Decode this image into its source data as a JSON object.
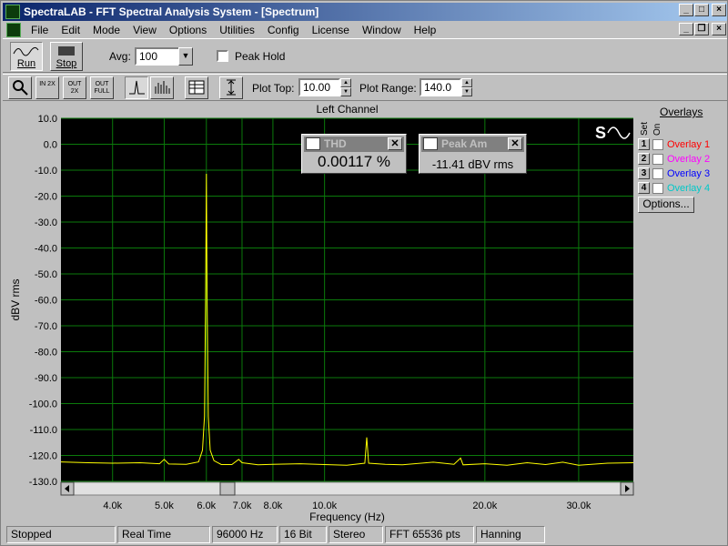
{
  "window": {
    "title": "SpectraLAB - FFT Spectral Analysis System - [Spectrum]",
    "controls": [
      "_",
      "□",
      "×"
    ],
    "doc_controls": [
      "_",
      "❐",
      "×"
    ]
  },
  "menu": [
    "File",
    "Edit",
    "Mode",
    "View",
    "Options",
    "Utilities",
    "Config",
    "License",
    "Window",
    "Help"
  ],
  "toolbar": {
    "run_label": "Run",
    "stop_label": "Stop",
    "avg_label": "Avg:",
    "avg_value": "100",
    "peak_hold_label": "Peak Hold",
    "zoom_in_label": "IN 2X",
    "zoom_out_label": "OUT 2X",
    "zoom_full_label": "OUT FULL",
    "plot_top_label": "Plot Top:",
    "plot_top_value": "10.00",
    "plot_range_label": "Plot Range:",
    "plot_range_value": "140.0"
  },
  "plot": {
    "channel_title": "Left Channel",
    "xlabel": "Frequency (Hz)",
    "ylabel": "dBV rms",
    "logo_text": "S",
    "background": "#000000",
    "grid_color": "#0b7a0b",
    "trace_color": "#ffff00"
  },
  "chart_data": {
    "type": "line",
    "title": "Left Channel",
    "xlabel": "Frequency (Hz)",
    "ylabel": "dBV rms",
    "x_scale": "log",
    "xlim": [
      3200,
      38000
    ],
    "ylim": [
      -130,
      10
    ],
    "x_ticks": [
      "4.0k",
      "5.0k",
      "6.0k",
      "7.0k",
      "8.0k",
      "10.0k",
      "20.0k",
      "30.0k"
    ],
    "x_tick_values": [
      4000,
      5000,
      6000,
      7000,
      8000,
      10000,
      20000,
      30000
    ],
    "y_ticks": [
      "10.0",
      "0.0",
      "-10.0",
      "-20.0",
      "-30.0",
      "-40.0",
      "-50.0",
      "-60.0",
      "-70.0",
      "-80.0",
      "-90.0",
      "-100.0",
      "-110.0",
      "-120.0",
      "-130.0"
    ],
    "y_tick_values": [
      10,
      0,
      -10,
      -20,
      -30,
      -40,
      -50,
      -60,
      -70,
      -80,
      -90,
      -100,
      -110,
      -120,
      -130
    ],
    "grid": true,
    "series": [
      {
        "points": [
          [
            3200,
            -122.5
          ],
          [
            3600,
            -122.8
          ],
          [
            4000,
            -123.0
          ],
          [
            4500,
            -122.8
          ],
          [
            4900,
            -123.2
          ],
          [
            5000,
            -121.5
          ],
          [
            5100,
            -123.3
          ],
          [
            5500,
            -123.4
          ],
          [
            5800,
            -122.5
          ],
          [
            5900,
            -118.0
          ],
          [
            5950,
            -105.0
          ],
          [
            5980,
            -60.0
          ],
          [
            6000,
            -11.4
          ],
          [
            6020,
            -60.0
          ],
          [
            6050,
            -105.0
          ],
          [
            6100,
            -118.0
          ],
          [
            6200,
            -122.0
          ],
          [
            6400,
            -123.5
          ],
          [
            6700,
            -123.5
          ],
          [
            6900,
            -121.5
          ],
          [
            7000,
            -122.8
          ],
          [
            7500,
            -123.6
          ],
          [
            8000,
            -123.4
          ],
          [
            9000,
            -123.2
          ],
          [
            10000,
            -123.5
          ],
          [
            11000,
            -123.8
          ],
          [
            11900,
            -123.0
          ],
          [
            12000,
            -113.0
          ],
          [
            12100,
            -123.0
          ],
          [
            13000,
            -123.4
          ],
          [
            14000,
            -123.6
          ],
          [
            16000,
            -122.6
          ],
          [
            17500,
            -123.4
          ],
          [
            18000,
            -121.0
          ],
          [
            18200,
            -123.6
          ],
          [
            20000,
            -123.2
          ],
          [
            22000,
            -123.8
          ],
          [
            24000,
            -122.8
          ],
          [
            26000,
            -123.5
          ],
          [
            28000,
            -122.6
          ],
          [
            30000,
            -123.8
          ],
          [
            34000,
            -123.0
          ],
          [
            38000,
            -122.8
          ]
        ]
      }
    ]
  },
  "readouts": {
    "thd_title": "THD",
    "thd_value": "0.00117 %",
    "peak_title": "Peak Am",
    "peak_value": "-11.41 dBV rms"
  },
  "overlays": {
    "title": "Overlays",
    "set_label": "Set",
    "on_label": "On",
    "items": [
      {
        "num": "1",
        "label": "Overlay 1",
        "color": "#ff0000"
      },
      {
        "num": "2",
        "label": "Overlay 2",
        "color": "#ff00ff"
      },
      {
        "num": "3",
        "label": "Overlay 3",
        "color": "#0000ff"
      },
      {
        "num": "4",
        "label": "Overlay 4",
        "color": "#00c8c8"
      }
    ],
    "options_label": "Options..."
  },
  "status": [
    "Stopped",
    "Real Time",
    "96000 Hz",
    "16 Bit",
    "Stereo",
    "FFT 65536 pts",
    "Hanning"
  ]
}
